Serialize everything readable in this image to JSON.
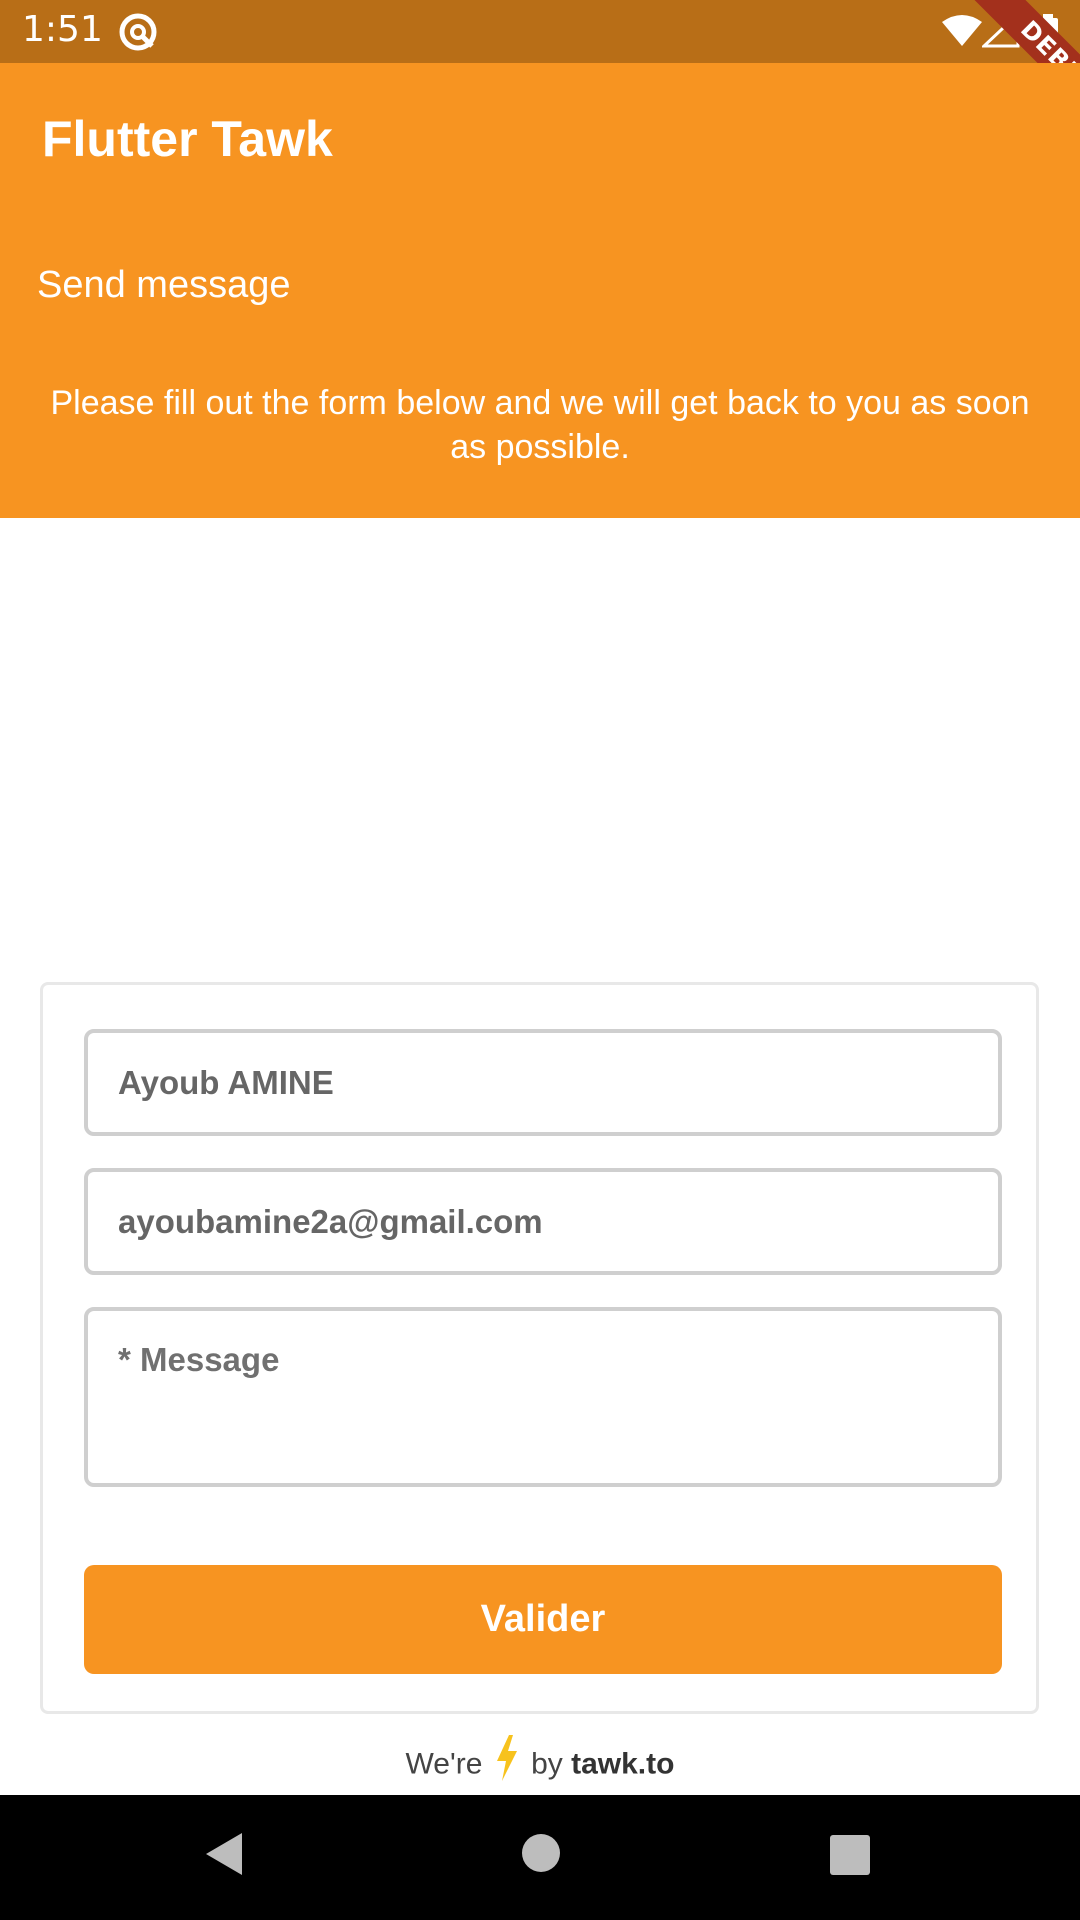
{
  "status_bar": {
    "time": "1:51",
    "app_icon": "at-sign-icon",
    "wifi_icon": "wifi-icon",
    "signal_icon": "signal-icon",
    "battery_icon": "battery-icon"
  },
  "debug_banner": "DEBUG",
  "app_bar": {
    "title": "Flutter Tawk"
  },
  "chat": {
    "heading": "Send message",
    "intro": "Please fill out the form below and we will get back to you as soon as possible."
  },
  "form": {
    "name_value": "Ayoub AMINE",
    "email_value": "ayoubamine2a@gmail.com",
    "message_placeholder": "* Message",
    "submit_label": "Valider"
  },
  "footer": {
    "prefix": "We're",
    "middle": "by",
    "brand": "tawk.to",
    "icon": "lightning-bolt-icon"
  },
  "nav": {
    "back_icon": "back-triangle-icon",
    "home_icon": "home-circle-icon",
    "recents_icon": "recents-square-icon"
  },
  "colors": {
    "accent": "#f79421",
    "status_bar": "#b86e17",
    "debug": "#a3301c"
  }
}
